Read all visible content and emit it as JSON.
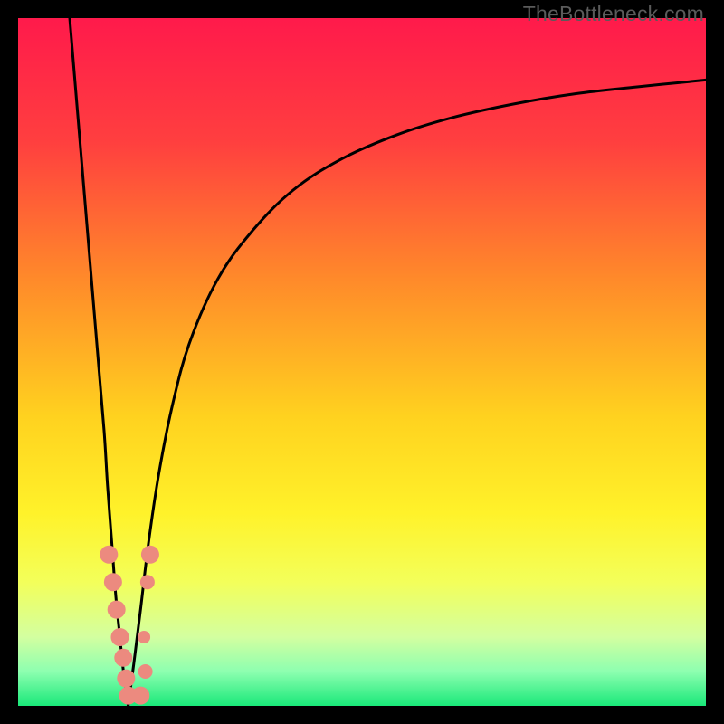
{
  "watermark": {
    "text": "TheBottleneck.com"
  },
  "colors": {
    "frame": "#000000",
    "gradient_stops": [
      {
        "pct": 0,
        "color": "#ff1a4b"
      },
      {
        "pct": 18,
        "color": "#ff3f3f"
      },
      {
        "pct": 38,
        "color": "#ff8a2a"
      },
      {
        "pct": 58,
        "color": "#ffd21f"
      },
      {
        "pct": 72,
        "color": "#fff22a"
      },
      {
        "pct": 82,
        "color": "#f3ff5a"
      },
      {
        "pct": 90,
        "color": "#d3ffa0"
      },
      {
        "pct": 95,
        "color": "#8dffb0"
      },
      {
        "pct": 100,
        "color": "#19e879"
      }
    ],
    "curve": "#000000",
    "marker_fill": "#ec8a7f",
    "marker_stroke": "#d96c5f"
  },
  "chart_data": {
    "type": "line",
    "title": "",
    "xlabel": "",
    "ylabel": "",
    "xlim": [
      0,
      100
    ],
    "ylim": [
      0,
      100
    ],
    "grid": false,
    "series": [
      {
        "name": "left-branch",
        "x": [
          7.5,
          8.5,
          9.5,
          10.5,
          11.5,
          12.5,
          13.0,
          13.6,
          14.2,
          14.8,
          15.2,
          15.7,
          16.0
        ],
        "y": [
          100,
          88,
          76,
          64,
          52,
          40,
          32,
          24,
          16,
          10,
          6,
          2,
          0
        ]
      },
      {
        "name": "right-branch",
        "x": [
          16.0,
          16.8,
          17.8,
          19.0,
          20.5,
          22.5,
          25,
          29,
          34,
          40,
          47,
          55,
          63,
          72,
          81,
          90,
          100
        ],
        "y": [
          0,
          6,
          14,
          24,
          34,
          44,
          53,
          62,
          69,
          75,
          79.5,
          83,
          85.5,
          87.5,
          89,
          90,
          91
        ]
      }
    ],
    "markers": [
      {
        "x": 13.2,
        "y": 22,
        "r": 10
      },
      {
        "x": 13.8,
        "y": 18,
        "r": 10
      },
      {
        "x": 14.3,
        "y": 14,
        "r": 10
      },
      {
        "x": 14.8,
        "y": 10,
        "r": 10
      },
      {
        "x": 15.3,
        "y": 7,
        "r": 10
      },
      {
        "x": 15.7,
        "y": 4,
        "r": 10
      },
      {
        "x": 16.0,
        "y": 1.5,
        "r": 10
      },
      {
        "x": 17.8,
        "y": 1.5,
        "r": 10
      },
      {
        "x": 18.8,
        "y": 18,
        "r": 8
      },
      {
        "x": 18.3,
        "y": 10,
        "r": 7
      },
      {
        "x": 18.5,
        "y": 5,
        "r": 8
      },
      {
        "x": 19.2,
        "y": 22,
        "r": 10
      }
    ]
  }
}
